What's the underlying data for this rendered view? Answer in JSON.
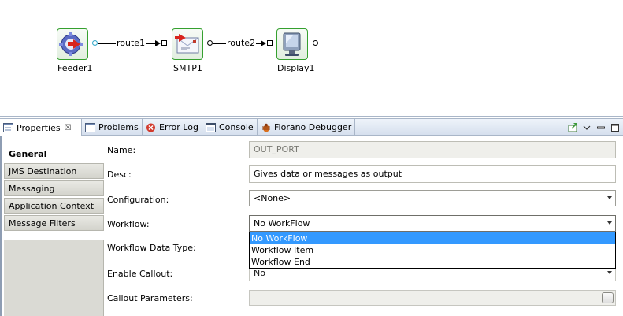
{
  "flow": {
    "nodes": [
      {
        "label": "Feeder1",
        "icon": "feeder-icon"
      },
      {
        "label": "SMTP1",
        "icon": "smtp-mail-icon"
      },
      {
        "label": "Display1",
        "icon": "display-monitor-icon"
      }
    ],
    "routes": [
      {
        "label": "route1"
      },
      {
        "label": "route2"
      }
    ]
  },
  "tabs": [
    {
      "label": "Properties",
      "icon": "properties-icon",
      "active": true
    },
    {
      "label": "Problems",
      "icon": "problems-icon"
    },
    {
      "label": "Error Log",
      "icon": "error-log-icon"
    },
    {
      "label": "Console",
      "icon": "console-icon"
    },
    {
      "label": "Fiorano Debugger",
      "icon": "debugger-bug-icon"
    }
  ],
  "sidebar": {
    "items": [
      {
        "label": "General",
        "active": true
      },
      {
        "label": "JMS Destination"
      },
      {
        "label": "Messaging"
      },
      {
        "label": "Application Context"
      },
      {
        "label": "Message Filters"
      }
    ]
  },
  "form": {
    "name_label": "Name:",
    "name_value": "OUT_PORT",
    "desc_label": "Desc:",
    "desc_value": "Gives data or messages as output",
    "configuration_label": "Configuration:",
    "configuration_value": "<None>",
    "workflow_label": "Workflow:",
    "workflow_value": "No WorkFlow",
    "workflow_options": [
      "No WorkFlow",
      "Workflow Item",
      "Workflow End"
    ],
    "workflow_data_type_label": "Workflow Data Type:",
    "enable_callout_label": "Enable Callout:",
    "enable_callout_value": "No",
    "callout_parameters_label": "Callout Parameters:"
  },
  "colors": {
    "node_border": "#35a02f",
    "selection": "#3399ff"
  }
}
